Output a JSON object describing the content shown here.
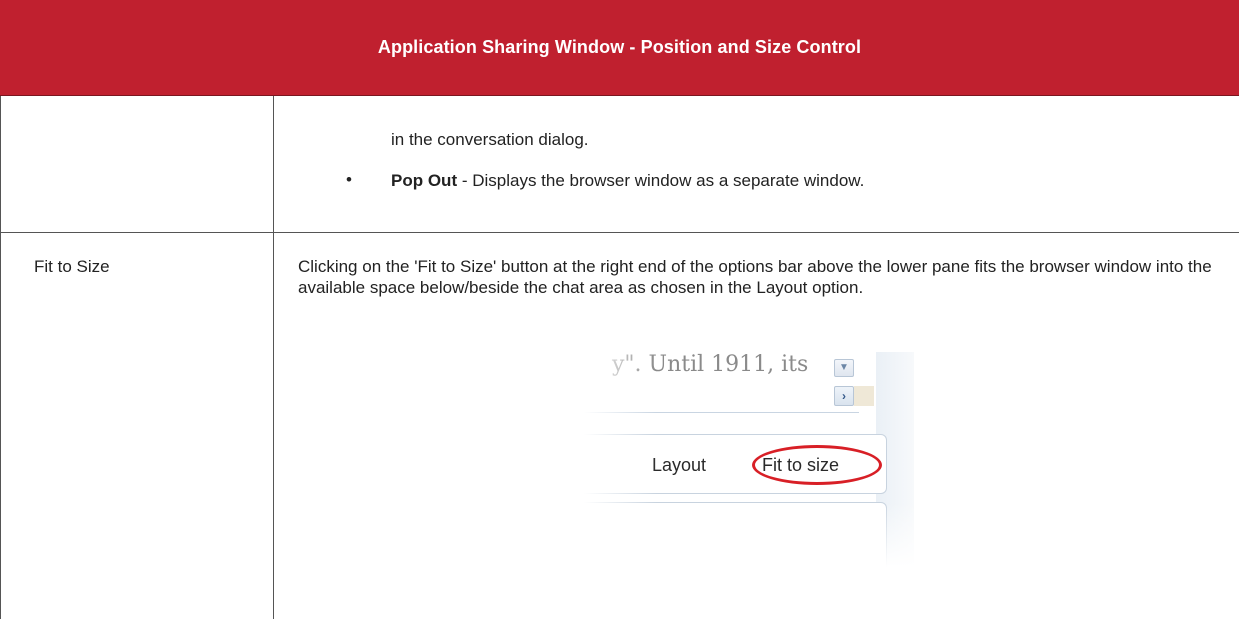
{
  "header": {
    "title": "Application Sharing Window - Position and Size Control",
    "background_color": "#c0202f"
  },
  "rows": [
    {
      "label": "",
      "continuation_text": "in the conversation dialog.",
      "bullet_symbol": "•",
      "bullet_term": "Pop Out",
      "bullet_desc": " - Displays the browser window as a separate window."
    },
    {
      "label": "Fit to Size",
      "description": "Clicking on the 'Fit to Size' button at the right end of the options bar above the lower pane fits the browser  window into the available space below/beside the chat area as chosen in the Layout option.",
      "screenshot": {
        "text_snippet": "y\". Until 1911, its",
        "scroll_down_icon": "chevron-down-icon",
        "scroll_right_icon": "chevron-right-icon",
        "layout_label": "Layout",
        "fit_label": "Fit to size",
        "highlight_color": "#d81f26"
      }
    }
  ]
}
